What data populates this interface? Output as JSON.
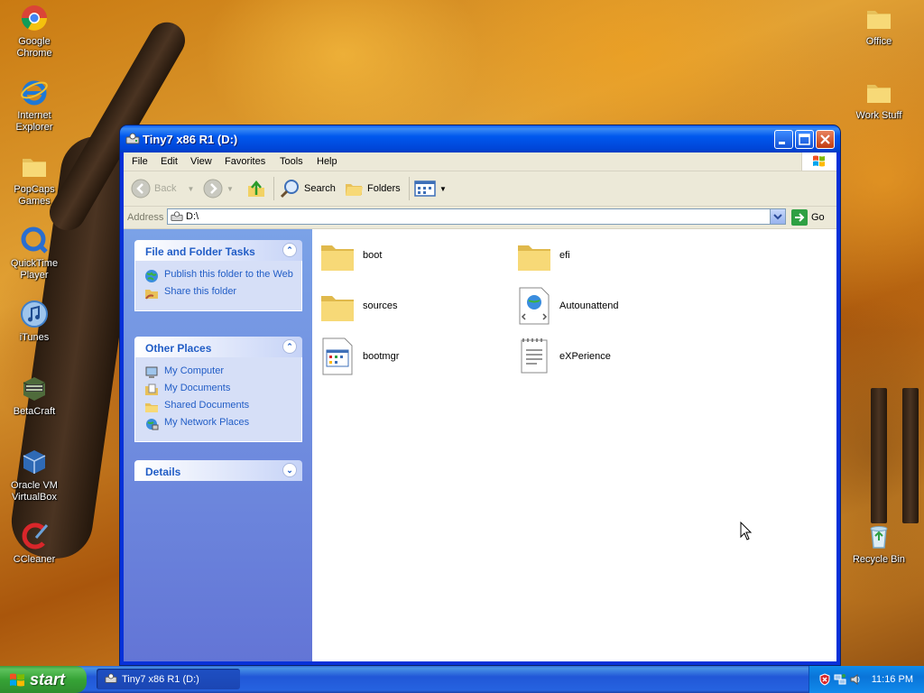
{
  "desktop": {
    "left_icons": [
      {
        "label": "Google Chrome",
        "icon": "chrome-icon"
      },
      {
        "label": "Internet Explorer",
        "icon": "ie-icon"
      },
      {
        "label": "PopCaps Games",
        "icon": "folder-icon"
      },
      {
        "label": "QuickTime Player",
        "icon": "quicktime-icon"
      },
      {
        "label": "iTunes",
        "icon": "itunes-icon"
      },
      {
        "label": "BetaCraft",
        "icon": "betacraft-icon"
      },
      {
        "label": "Oracle VM VirtualBox",
        "icon": "virtualbox-icon"
      },
      {
        "label": "CCleaner",
        "icon": "ccleaner-icon"
      }
    ],
    "right_icons": [
      {
        "label": "Office",
        "icon": "folder-icon"
      },
      {
        "label": "Work Stuff",
        "icon": "folder-icon"
      },
      {
        "label": "Recycle Bin",
        "icon": "recycle-bin-icon"
      }
    ]
  },
  "window": {
    "title": "Tiny7 x86 R1 (D:)",
    "menu": [
      "File",
      "Edit",
      "View",
      "Favorites",
      "Tools",
      "Help"
    ],
    "toolbar": {
      "back": "Back",
      "search": "Search",
      "folders": "Folders"
    },
    "address": {
      "label": "Address",
      "value": "D:\\",
      "go": "Go"
    },
    "tasks": {
      "file_folder": {
        "title": "File and Folder Tasks",
        "items": [
          "Publish this folder to the Web",
          "Share this folder"
        ]
      },
      "other_places": {
        "title": "Other Places",
        "items": [
          "My Computer",
          "My Documents",
          "Shared Documents",
          "My Network Places"
        ]
      },
      "details": {
        "title": "Details"
      }
    },
    "files": [
      {
        "name": "boot",
        "type": "folder"
      },
      {
        "name": "efi",
        "type": "folder"
      },
      {
        "name": "sources",
        "type": "folder"
      },
      {
        "name": "Autounattend",
        "type": "xml-document"
      },
      {
        "name": "bootmgr",
        "type": "system-file"
      },
      {
        "name": "eXPerience",
        "type": "text-document"
      }
    ]
  },
  "taskbar": {
    "start_label": "start",
    "task_label": "Tiny7 x86 R1 (D:)",
    "clock": "11:16 PM"
  },
  "colors": {
    "titlebar": "#0058ee",
    "taskpane": "#7ba2e7",
    "link": "#215dc6",
    "start_green": "#36a336"
  }
}
